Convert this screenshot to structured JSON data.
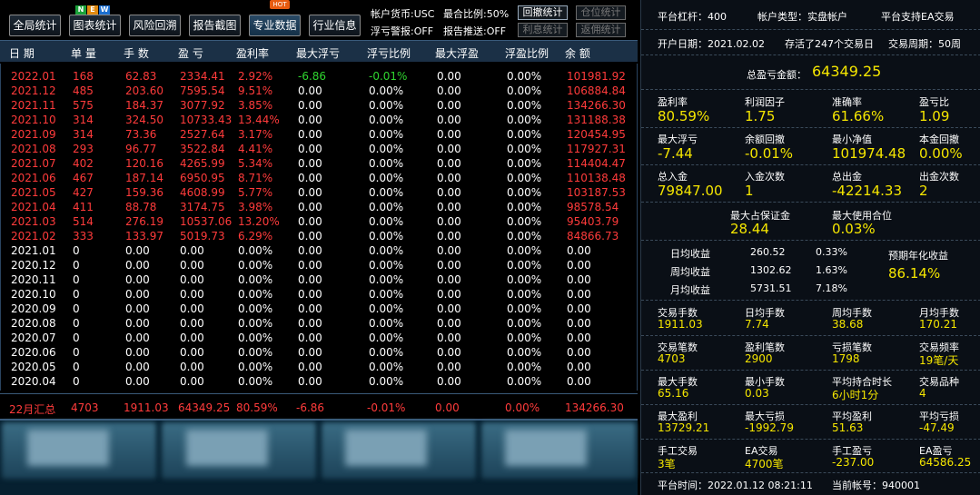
{
  "toolbar": {
    "buttons": [
      "全局统计",
      "图表统计",
      "风险回溯",
      "报告截图",
      "专业数据",
      "行业信息"
    ],
    "badge_new": [
      "N",
      "E",
      "W"
    ],
    "badge_hot": "HOT",
    "account_currency": "帐户货币:USC",
    "max_ratio": "最合比例:50%",
    "float_alert": "浮亏警报:OFF",
    "report_push": "报告推送:OFF",
    "small_buttons": [
      "回撤统计",
      "仓位统计",
      "利息统计",
      "返佣统计"
    ]
  },
  "table": {
    "headers": [
      "日 期",
      "单 量",
      "手 数",
      "盈 亏",
      "盈利率",
      "最大浮亏",
      "浮亏比例",
      "最大浮盈",
      "浮盈比例",
      "余 额"
    ],
    "rows": [
      [
        "2022.01",
        "168",
        "62.83",
        "2334.41",
        "2.92%",
        "-6.86",
        "-0.01%",
        "0.00",
        "0.00%",
        "101981.92"
      ],
      [
        "2021.12",
        "485",
        "203.60",
        "7595.54",
        "9.51%",
        "0.00",
        "0.00%",
        "0.00",
        "0.00%",
        "106884.84"
      ],
      [
        "2021.11",
        "575",
        "184.37",
        "3077.92",
        "3.85%",
        "0.00",
        "0.00%",
        "0.00",
        "0.00%",
        "134266.30"
      ],
      [
        "2021.10",
        "314",
        "324.50",
        "10733.43",
        "13.44%",
        "0.00",
        "0.00%",
        "0.00",
        "0.00%",
        "131188.38"
      ],
      [
        "2021.09",
        "314",
        "73.36",
        "2527.64",
        "3.17%",
        "0.00",
        "0.00%",
        "0.00",
        "0.00%",
        "120454.95"
      ],
      [
        "2021.08",
        "293",
        "96.77",
        "3522.84",
        "4.41%",
        "0.00",
        "0.00%",
        "0.00",
        "0.00%",
        "117927.31"
      ],
      [
        "2021.07",
        "402",
        "120.16",
        "4265.99",
        "5.34%",
        "0.00",
        "0.00%",
        "0.00",
        "0.00%",
        "114404.47"
      ],
      [
        "2021.06",
        "467",
        "187.14",
        "6950.95",
        "8.71%",
        "0.00",
        "0.00%",
        "0.00",
        "0.00%",
        "110138.48"
      ],
      [
        "2021.05",
        "427",
        "159.36",
        "4608.99",
        "5.77%",
        "0.00",
        "0.00%",
        "0.00",
        "0.00%",
        "103187.53"
      ],
      [
        "2021.04",
        "411",
        "88.78",
        "3174.75",
        "3.98%",
        "0.00",
        "0.00%",
        "0.00",
        "0.00%",
        "98578.54"
      ],
      [
        "2021.03",
        "514",
        "276.19",
        "10537.06",
        "13.20%",
        "0.00",
        "0.00%",
        "0.00",
        "0.00%",
        "95403.79"
      ],
      [
        "2021.02",
        "333",
        "133.97",
        "5019.73",
        "6.29%",
        "0.00",
        "0.00%",
        "0.00",
        "0.00%",
        "84866.73"
      ],
      [
        "2021.01",
        "0",
        "0.00",
        "0.00",
        "0.00%",
        "0.00",
        "0.00%",
        "0.00",
        "0.00%",
        "0.00"
      ],
      [
        "2020.12",
        "0",
        "0.00",
        "0.00",
        "0.00%",
        "0.00",
        "0.00%",
        "0.00",
        "0.00%",
        "0.00"
      ],
      [
        "2020.11",
        "0",
        "0.00",
        "0.00",
        "0.00%",
        "0.00",
        "0.00%",
        "0.00",
        "0.00%",
        "0.00"
      ],
      [
        "2020.10",
        "0",
        "0.00",
        "0.00",
        "0.00%",
        "0.00",
        "0.00%",
        "0.00",
        "0.00%",
        "0.00"
      ],
      [
        "2020.09",
        "0",
        "0.00",
        "0.00",
        "0.00%",
        "0.00",
        "0.00%",
        "0.00",
        "0.00%",
        "0.00"
      ],
      [
        "2020.08",
        "0",
        "0.00",
        "0.00",
        "0.00%",
        "0.00",
        "0.00%",
        "0.00",
        "0.00%",
        "0.00"
      ],
      [
        "2020.07",
        "0",
        "0.00",
        "0.00",
        "0.00%",
        "0.00",
        "0.00%",
        "0.00",
        "0.00%",
        "0.00"
      ],
      [
        "2020.06",
        "0",
        "0.00",
        "0.00",
        "0.00%",
        "0.00",
        "0.00%",
        "0.00",
        "0.00%",
        "0.00"
      ],
      [
        "2020.05",
        "0",
        "0.00",
        "0.00",
        "0.00%",
        "0.00",
        "0.00%",
        "0.00",
        "0.00%",
        "0.00"
      ],
      [
        "2020.04",
        "0",
        "0.00",
        "0.00",
        "0.00%",
        "0.00",
        "0.00%",
        "0.00",
        "0.00%",
        "0.00"
      ]
    ],
    "summary": [
      "22月汇总",
      "4703",
      "1911.03",
      "64349.25",
      "80.59%",
      "-6.86",
      "-0.01%",
      "0.00",
      "0.00%",
      "134266.30"
    ]
  },
  "right": {
    "leverage": "平台杠杆：400",
    "account_type": "帐户类型：实盘帐户",
    "ea_support": "平台支持EA交易",
    "open_date": "开户日期：2021.02.02",
    "survived": "存活了247个交易日",
    "trade_cycle": "交易周期：50周",
    "total_pl_label": "总盈亏金额：",
    "total_pl_value": "64349.25",
    "stats1": [
      {
        "label": "盈利率",
        "value": "80.59%"
      },
      {
        "label": "利润因子",
        "value": "1.75"
      },
      {
        "label": "准确率",
        "value": "61.66%"
      },
      {
        "label": "盈亏比",
        "value": "1.09"
      },
      {
        "label": "最大浮亏",
        "value": "-7.44"
      },
      {
        "label": "余额回撤",
        "value": "-0.01%"
      },
      {
        "label": "最小净值",
        "value": "101974.48"
      },
      {
        "label": "本金回撤",
        "value": "0.00%"
      },
      {
        "label": "总入金",
        "value": "79847.00"
      },
      {
        "label": "入金次数",
        "value": "1"
      },
      {
        "label": "总出金",
        "value": "-42214.33"
      },
      {
        "label": "出金次数",
        "value": "2"
      }
    ],
    "max_margin_label": "最大占保证金",
    "max_margin_value": "28.44",
    "max_position_label": "最大使用合位",
    "max_position_value": "0.03%",
    "avg_rows": [
      {
        "label": "日均收益",
        "value": "260.52",
        "pct": "0.33%"
      },
      {
        "label": "周均收益",
        "value": "1302.62",
        "pct": "1.63%"
      },
      {
        "label": "月均收益",
        "value": "5731.51",
        "pct": "7.18%"
      }
    ],
    "annual_label": "预期年化收益",
    "annual_value": "86.14%",
    "stats2": [
      {
        "label": "交易手数",
        "value": "1911.03"
      },
      {
        "label": "日均手数",
        "value": "7.74"
      },
      {
        "label": "周均手数",
        "value": "38.68"
      },
      {
        "label": "月均手数",
        "value": "170.21"
      },
      {
        "label": "交易笔数",
        "value": "4703"
      },
      {
        "label": "盈利笔数",
        "value": "2900"
      },
      {
        "label": "亏损笔数",
        "value": "1798"
      },
      {
        "label": "交易频率",
        "value": "19笔/天"
      },
      {
        "label": "最大手数",
        "value": "65.16"
      },
      {
        "label": "最小手数",
        "value": "0.03"
      },
      {
        "label": "平均持合时长",
        "value": "6小时1分"
      },
      {
        "label": "交易品种",
        "value": "4"
      },
      {
        "label": "最大盈利",
        "value": "13729.21"
      },
      {
        "label": "最大亏损",
        "value": "-1992.79"
      },
      {
        "label": "平均盈利",
        "value": "51.63"
      },
      {
        "label": "平均亏损",
        "value": "-47.49"
      },
      {
        "label": "手工交易",
        "value": "3笔"
      },
      {
        "label": "EA交易",
        "value": "4700笔"
      },
      {
        "label": "手工盈亏",
        "value": "-237.00"
      },
      {
        "label": "EA盈亏",
        "value": "64586.25"
      }
    ],
    "platform_time": "平台时间：2022.01.12 08:21:11",
    "current_account": "当前帐号：940001"
  },
  "colors": {
    "red": "#ff3b3b",
    "white": "#ffffff",
    "green": "#2fd52f",
    "yellow": "#f5e600",
    "header_bg": "#1b3046"
  }
}
